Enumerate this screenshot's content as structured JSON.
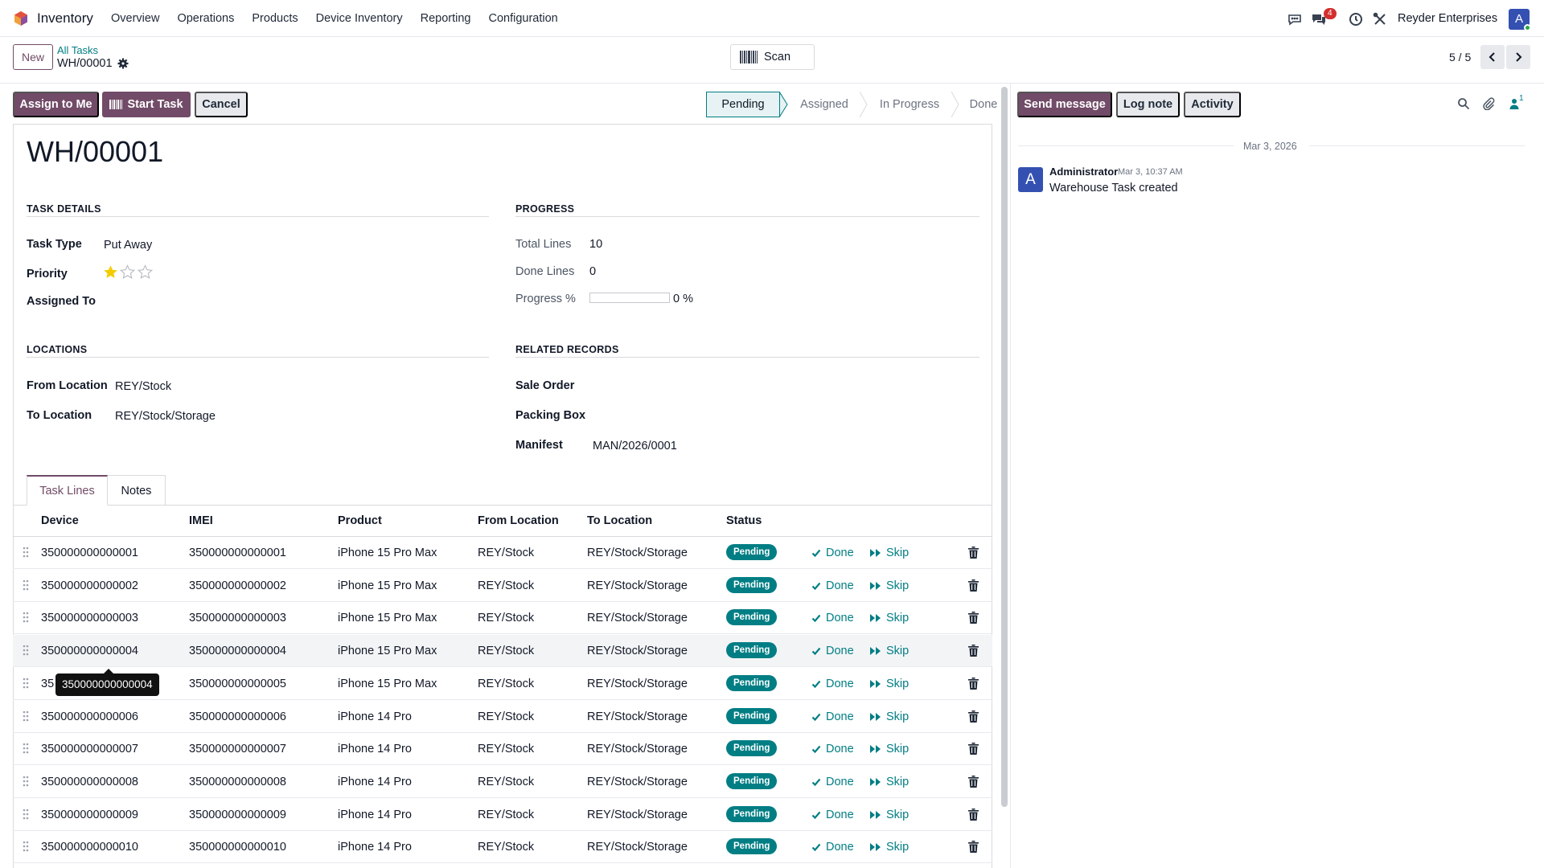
{
  "navbar": {
    "app_name": "Inventory",
    "menu": [
      "Overview",
      "Operations",
      "Products",
      "Device Inventory",
      "Reporting",
      "Configuration"
    ],
    "messages_badge": "4",
    "company": "Reyder Enterprises",
    "avatar_letter": "A"
  },
  "control_panel": {
    "new_label": "New",
    "breadcrumb_parent": "All Tasks",
    "breadcrumb_current": "WH/00001",
    "scan_label": "Scan",
    "pager": "5 / 5"
  },
  "actions": {
    "assign": "Assign to Me",
    "start": "Start Task",
    "cancel": "Cancel"
  },
  "status_stages": [
    "Pending",
    "Assigned",
    "In Progress",
    "Done"
  ],
  "status_active": "Pending",
  "form": {
    "title": "WH/00001",
    "task_details_title": "TASK DETAILS",
    "task_type_label": "Task Type",
    "task_type_value": "Put Away",
    "priority_label": "Priority",
    "priority_value": 1,
    "priority_max": 3,
    "assigned_to_label": "Assigned To",
    "progress_title": "PROGRESS",
    "total_lines_label": "Total Lines",
    "total_lines_value": "10",
    "done_lines_label": "Done Lines",
    "done_lines_value": "0",
    "progress_label": "Progress %",
    "progress_value": "0 %",
    "progress_fraction": 0,
    "locations_title": "LOCATIONS",
    "from_location_label": "From Location",
    "from_location_value": "REY/Stock",
    "to_location_label": "To Location",
    "to_location_value": "REY/Stock/Storage",
    "related_title": "RELATED RECORDS",
    "sale_order_label": "Sale Order",
    "packing_box_label": "Packing Box",
    "manifest_label": "Manifest",
    "manifest_value": "MAN/2026/0001"
  },
  "tabs": [
    "Task Lines",
    "Notes"
  ],
  "table": {
    "headers": [
      "Device",
      "IMEI",
      "Product",
      "From Location",
      "To Location",
      "Status"
    ],
    "done_label": "Done",
    "skip_label": "Skip",
    "rows": [
      {
        "device": "350000000000001",
        "imei": "350000000000001",
        "product": "iPhone 15 Pro Max",
        "from": "REY/Stock",
        "to": "REY/Stock/Storage",
        "status": "Pending"
      },
      {
        "device": "350000000000002",
        "imei": "350000000000002",
        "product": "iPhone 15 Pro Max",
        "from": "REY/Stock",
        "to": "REY/Stock/Storage",
        "status": "Pending"
      },
      {
        "device": "350000000000003",
        "imei": "350000000000003",
        "product": "iPhone 15 Pro Max",
        "from": "REY/Stock",
        "to": "REY/Stock/Storage",
        "status": "Pending"
      },
      {
        "device": "350000000000004",
        "imei": "350000000000004",
        "product": "iPhone 15 Pro Max",
        "from": "REY/Stock",
        "to": "REY/Stock/Storage",
        "status": "Pending"
      },
      {
        "device": "35",
        "imei": "350000000000005",
        "product": "iPhone 15 Pro Max",
        "from": "REY/Stock",
        "to": "REY/Stock/Storage",
        "status": "Pending"
      },
      {
        "device": "350000000000006",
        "imei": "350000000000006",
        "product": "iPhone 14 Pro",
        "from": "REY/Stock",
        "to": "REY/Stock/Storage",
        "status": "Pending"
      },
      {
        "device": "350000000000007",
        "imei": "350000000000007",
        "product": "iPhone 14 Pro",
        "from": "REY/Stock",
        "to": "REY/Stock/Storage",
        "status": "Pending"
      },
      {
        "device": "350000000000008",
        "imei": "350000000000008",
        "product": "iPhone 14 Pro",
        "from": "REY/Stock",
        "to": "REY/Stock/Storage",
        "status": "Pending"
      },
      {
        "device": "350000000000009",
        "imei": "350000000000009",
        "product": "iPhone 14 Pro",
        "from": "REY/Stock",
        "to": "REY/Stock/Storage",
        "status": "Pending"
      },
      {
        "device": "350000000000010",
        "imei": "350000000000010",
        "product": "iPhone 14 Pro",
        "from": "REY/Stock",
        "to": "REY/Stock/Storage",
        "status": "Pending"
      }
    ]
  },
  "tooltip": "350000000000004",
  "chatter": {
    "send_message": "Send message",
    "log_note": "Log note",
    "activity": "Activity",
    "followers_count": "1",
    "date_separator": "Mar 3, 2026",
    "message": {
      "avatar_letter": "A",
      "author": "Administrator",
      "time": "Mar 3, 10:37 AM",
      "body": "Warehouse Task created"
    }
  },
  "colors": {
    "primary": "#714b67",
    "accent": "#017e84",
    "badge": "#d32f2f",
    "avatar": "#3451b2"
  }
}
